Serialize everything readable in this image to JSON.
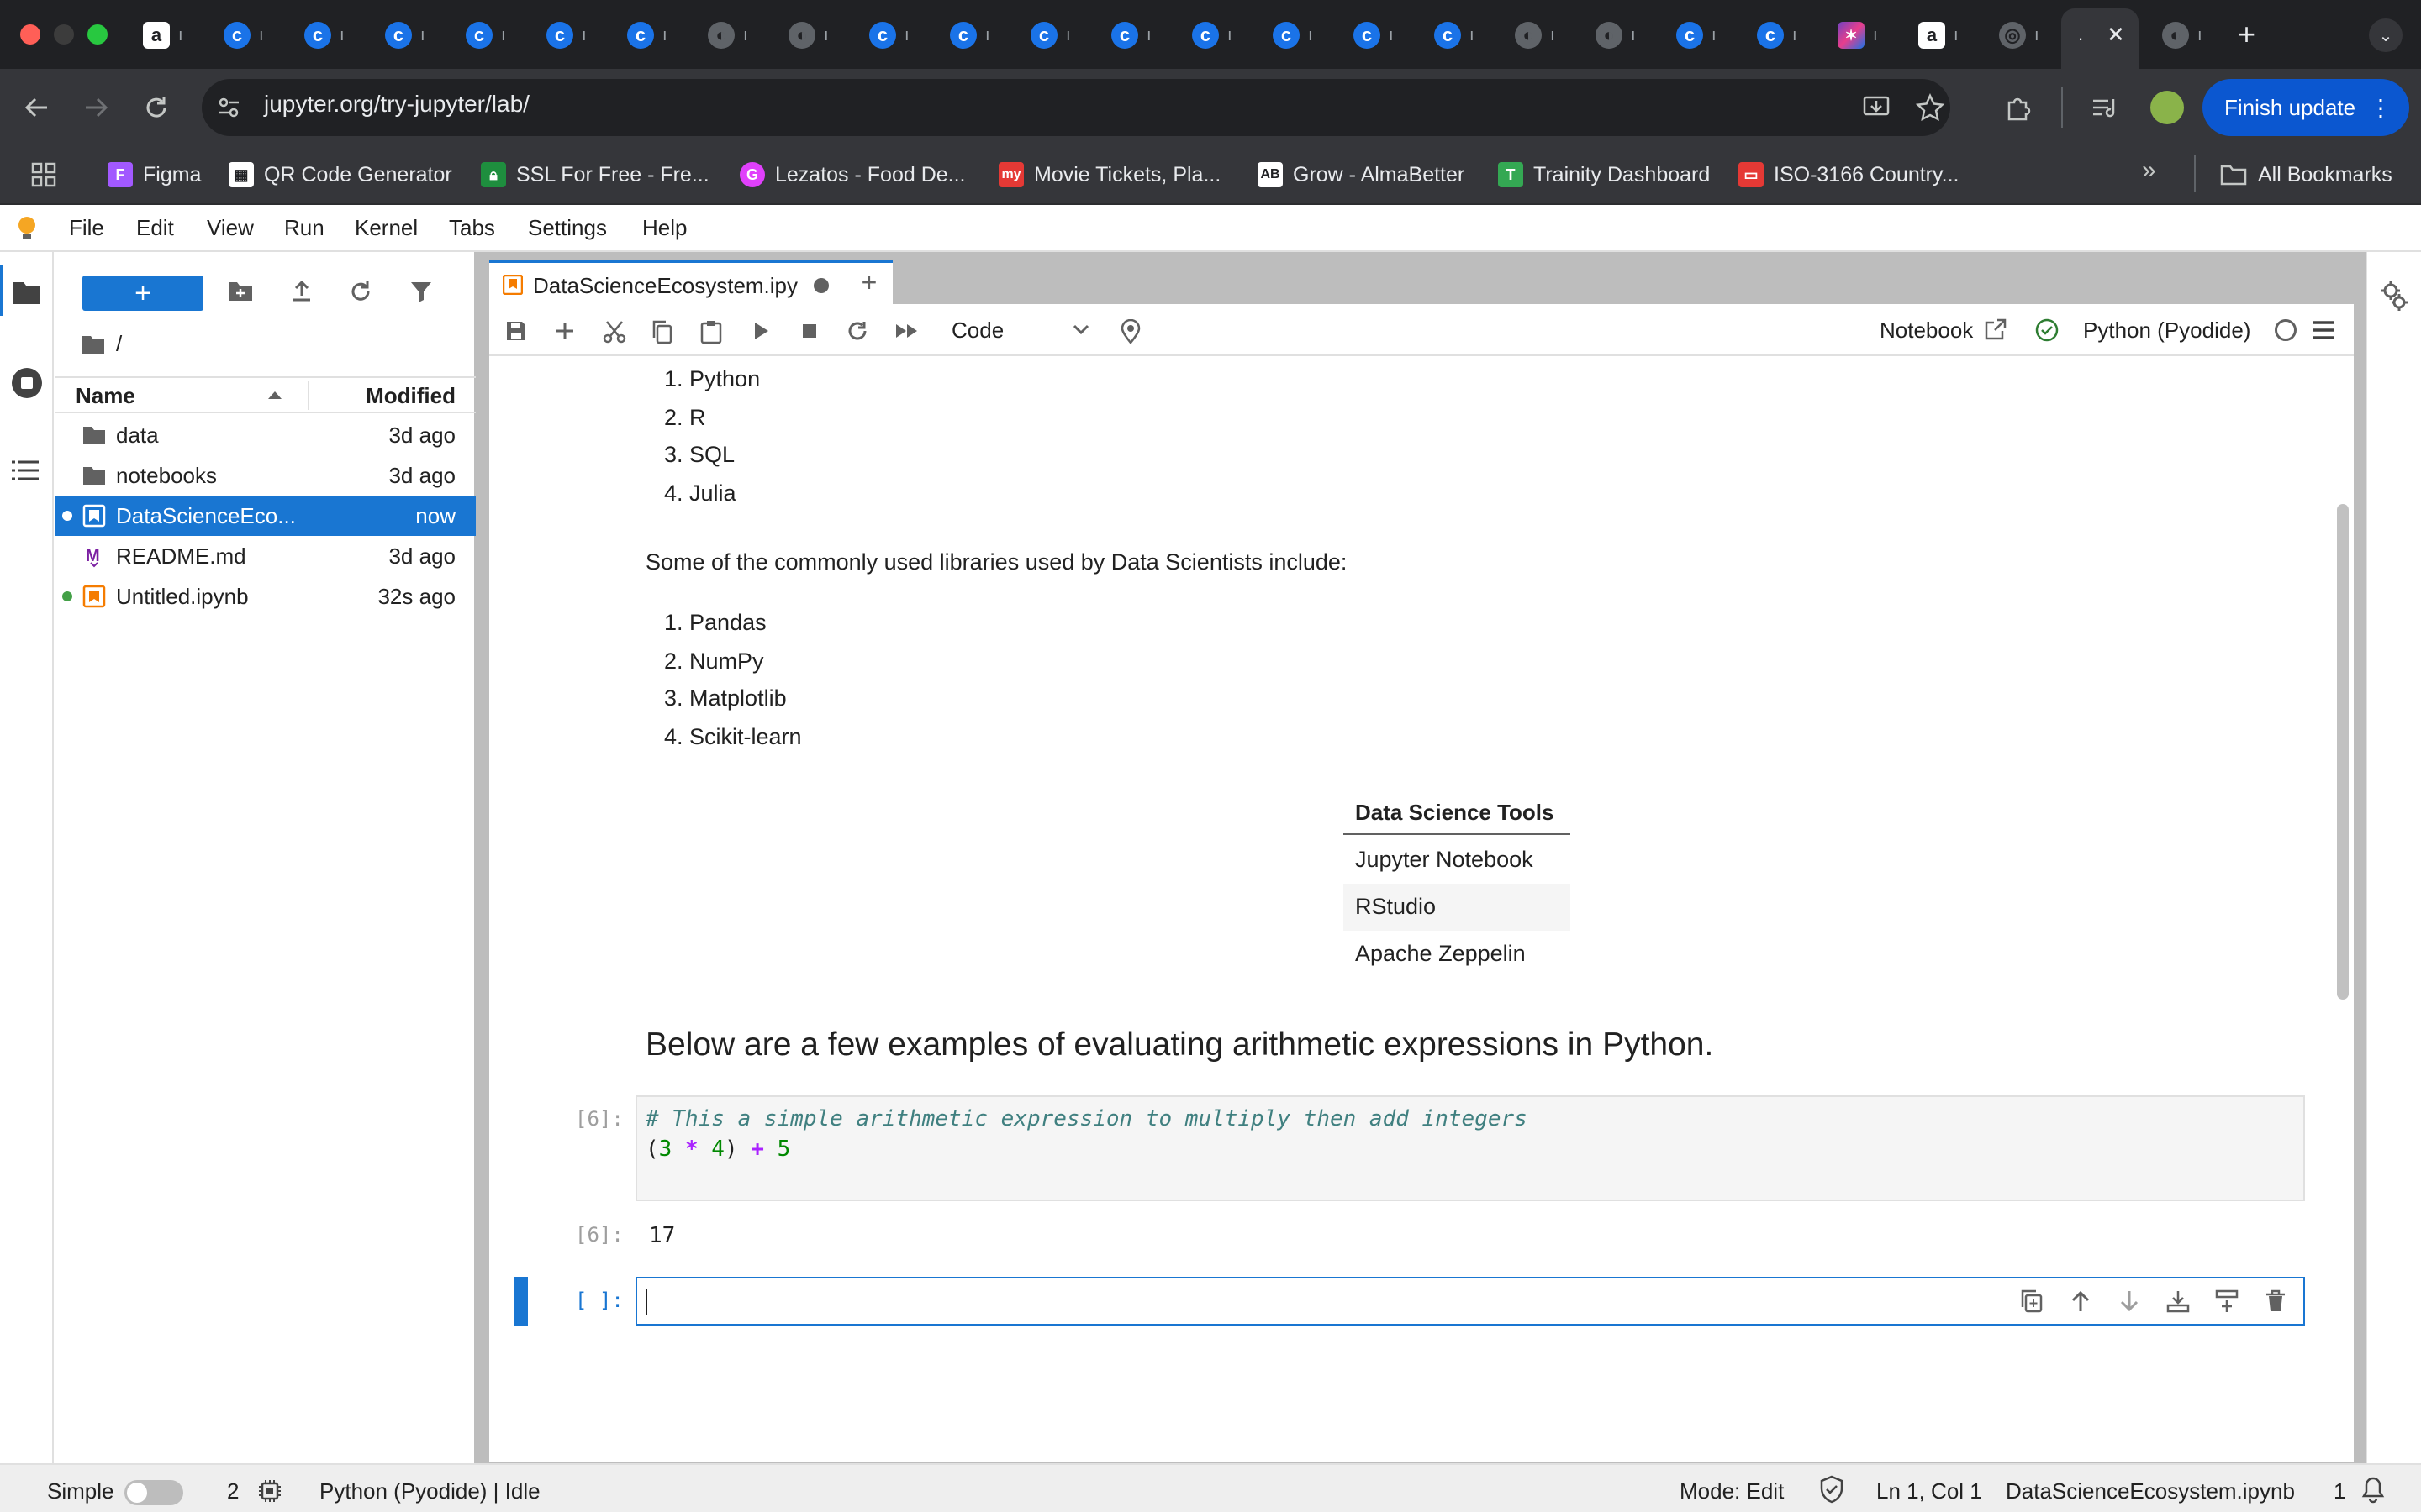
{
  "browser": {
    "tab_fragments": [
      "ı",
      "ı",
      "ı",
      "ı",
      "ı",
      "ı",
      "ı",
      "ı",
      "ı",
      "ı",
      "ı",
      "ı",
      "ı",
      "ı",
      "ı",
      "ı",
      "ı",
      "ı",
      "ı",
      "ı",
      "ı",
      "ı",
      "ı",
      "ı",
      "ı",
      "ı",
      "ı"
    ],
    "active_tab_label": ".",
    "url": "jupyter.org/try-jupyter/lab/",
    "finish_update": "Finish update",
    "bookmarks": [
      {
        "label": "Figma",
        "icon": "figma-icon",
        "color": "#a259ff"
      },
      {
        "label": "QR Code Generator",
        "icon": "qr-icon",
        "color": "#ffffff"
      },
      {
        "label": "SSL For Free - Fre...",
        "icon": "lock-icon",
        "color": "#1e8e3e"
      },
      {
        "label": "Lezatos - Food De...",
        "icon": "lezatos-icon",
        "color": "#e040fb"
      },
      {
        "label": "Movie Tickets, Pla...",
        "icon": "bookmyshow-icon",
        "color": "#e53935"
      },
      {
        "label": "Grow - AlmaBetter",
        "icon": "almabetter-icon",
        "color": "#ffffff"
      },
      {
        "label": "Trainity Dashboard",
        "icon": "trainity-icon",
        "color": "#34a853"
      },
      {
        "label": "ISO-3166 Country...",
        "icon": "oracle-icon",
        "color": "#e53935"
      }
    ],
    "all_bookmarks": "All Bookmarks"
  },
  "menu": [
    "File",
    "Edit",
    "View",
    "Run",
    "Kernel",
    "Tabs",
    "Settings",
    "Help"
  ],
  "filebrowser": {
    "new_label": "+",
    "crumb": "/",
    "col_name": "Name",
    "col_modified": "Modified",
    "rows": [
      {
        "name": "data",
        "modified": "3d ago",
        "type": "folder"
      },
      {
        "name": "notebooks",
        "modified": "3d ago",
        "type": "folder"
      },
      {
        "name": "DataScienceEco...",
        "modified": "now",
        "type": "notebook"
      },
      {
        "name": "README.md",
        "modified": "3d ago",
        "type": "markdown"
      },
      {
        "name": "Untitled.ipynb",
        "modified": "32s ago",
        "type": "notebook"
      }
    ]
  },
  "notebook": {
    "tab_title": "DataScienceEcosystem.ipy",
    "cell_type": "Code",
    "notebook_label": "Notebook",
    "kernel": "Python (Pyodide)",
    "languages": [
      "Python",
      "R",
      "SQL",
      "Julia"
    ],
    "libraries_intro": "Some of the commonly used libraries used by Data Scientists include:",
    "libraries": [
      "Pandas",
      "NumPy",
      "Matplotlib",
      "Scikit-learn"
    ],
    "tools_table": {
      "header": "Data Science Tools",
      "rows": [
        "Jupyter Notebook",
        "RStudio",
        "Apache Zeppelin"
      ]
    },
    "heading": "Below are a few examples of evaluating arithmetic expressions in Python.",
    "code_prompt": "[6]:",
    "code_comment": "# This a simple arithmetic expression to multiply then add integers",
    "code_line2": {
      "open": "(",
      "a": "3",
      "op1": "*",
      "b": "4",
      "close": ")",
      "op2": "+",
      "c": "5"
    },
    "output_prompt": "[6]:",
    "output": "17",
    "empty_prompt": "[ ]:"
  },
  "statusbar": {
    "mode_label": "Simple",
    "count": "2",
    "kernel_status": "Python (Pyodide) | Idle",
    "mode": "Mode: Edit",
    "position": "Ln 1, Col 1",
    "filename": "DataScienceEcosystem.ipynb",
    "notifications": "1"
  },
  "colors": {
    "accent": "#1976d2",
    "chrome_dark": "#202124",
    "finish_update": "#0b57d0"
  }
}
